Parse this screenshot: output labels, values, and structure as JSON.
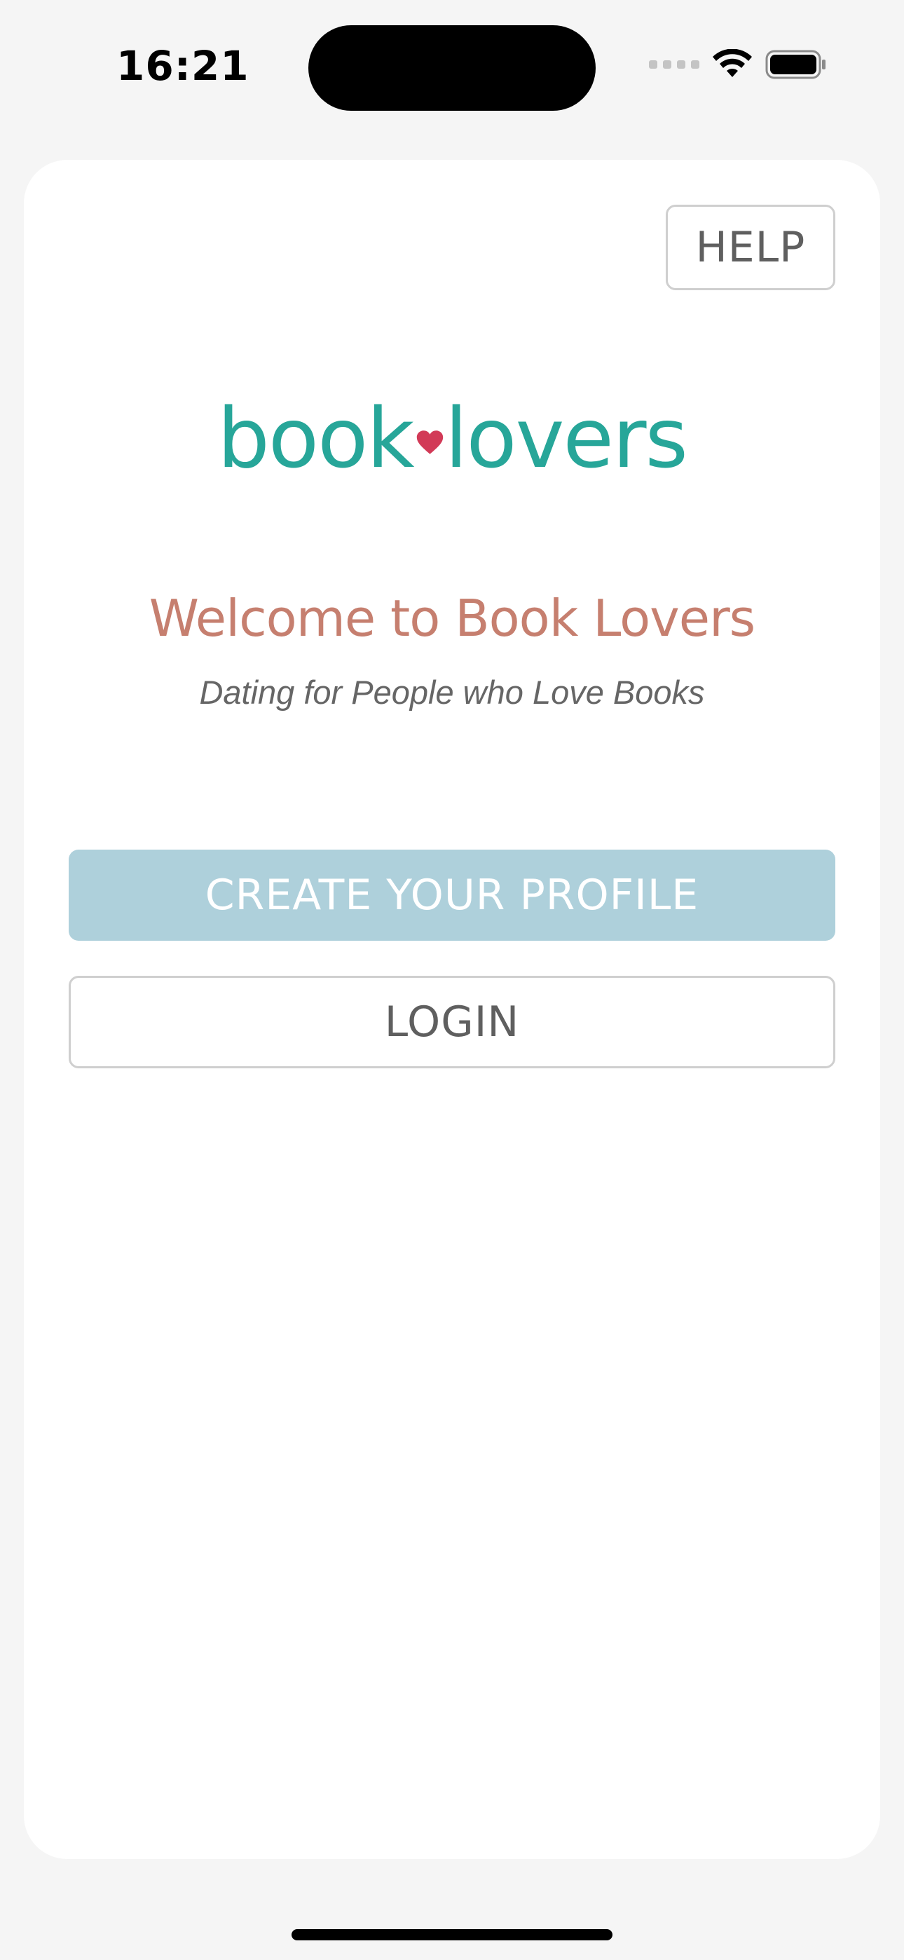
{
  "status_bar": {
    "time": "16:21",
    "signal_icon": "cellular-signal-icon",
    "wifi_icon": "wifi-icon",
    "battery_icon": "battery-icon"
  },
  "header": {
    "help_label": "HELP"
  },
  "logo": {
    "text_left": "book",
    "text_right": "lovers",
    "heart_icon": "heart-icon",
    "text_color": "#27a699",
    "heart_color": "#d23a57"
  },
  "welcome": {
    "title": "Welcome to Book Lovers",
    "subtitle": "Dating for People who Love Books"
  },
  "actions": {
    "create_profile_label": "CREATE YOUR PROFILE",
    "login_label": "LOGIN"
  },
  "colors": {
    "accent_button": "#aed0db",
    "title": "#c67f6f",
    "background": "#f5f5f5"
  }
}
